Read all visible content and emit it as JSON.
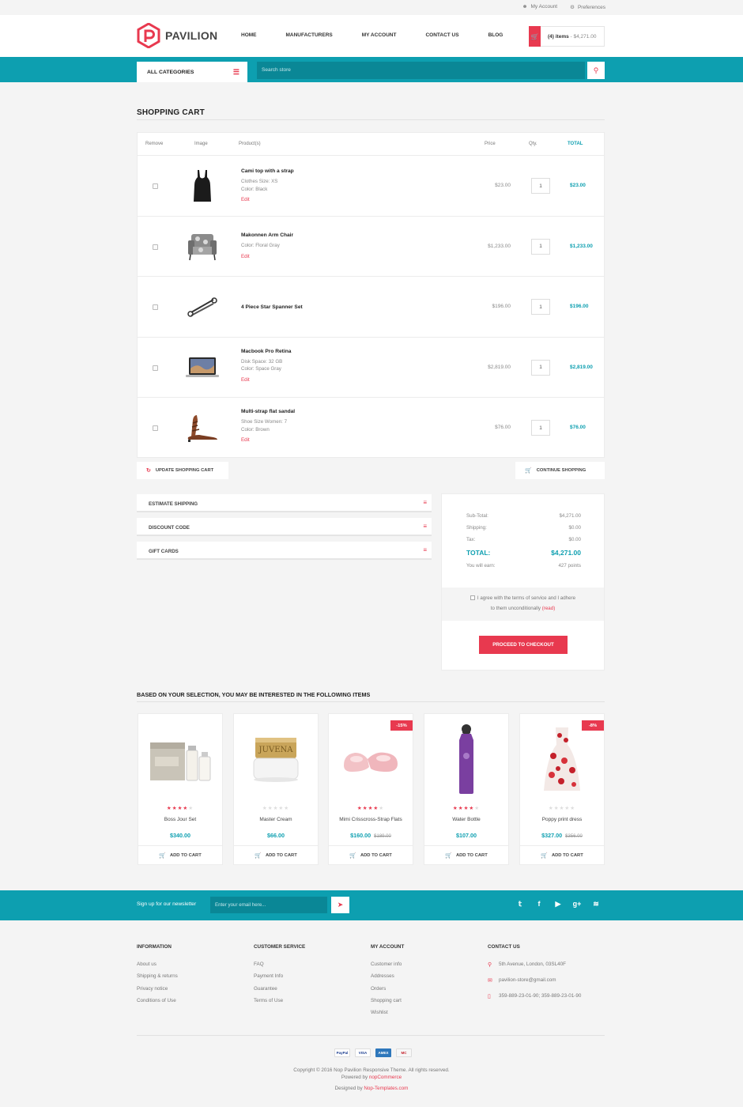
{
  "topbar": {
    "my_account": "My Account",
    "preferences": "Preferences"
  },
  "brand": {
    "name": "PAVILION",
    "accent": "#e8394f",
    "teal": "#0d9fb0"
  },
  "nav": [
    "HOME",
    "MANUFACTURERS",
    "MY ACCOUNT",
    "CONTACT US",
    "BLOG"
  ],
  "minicart": {
    "count": "(4) items",
    "amount": "- $4,271.00"
  },
  "search": {
    "categories": "ALL CATEGORIES",
    "placeholder": "Search store"
  },
  "page_title": "SHOPPING CART",
  "cart": {
    "headers": {
      "remove": "Remove",
      "image": "Image",
      "product": "Product(s)",
      "price": "Price",
      "qty": "Qty.",
      "total": "TOTAL"
    },
    "items": [
      {
        "name": "Cami top with a strap",
        "attrs": [
          "Clothes Size: XS",
          "Color: Black"
        ],
        "edit": "Edit",
        "price": "$23.00",
        "qty": "1",
        "total": "$23.00"
      },
      {
        "name": "Makonnen Arm Chair",
        "attrs": [
          "Color: Floral Gray"
        ],
        "edit": "Edit",
        "price": "$1,233.00",
        "qty": "1",
        "total": "$1,233.00"
      },
      {
        "name": "4 Piece Star Spanner Set",
        "attrs": [],
        "edit": "",
        "price": "$196.00",
        "qty": "1",
        "total": "$196.00"
      },
      {
        "name": "Macbook Pro Retina",
        "attrs": [
          "Disk Space: 32 GB",
          "Color: Space Gray"
        ],
        "edit": "Edit",
        "price": "$2,819.00",
        "qty": "1",
        "total": "$2,819.00"
      },
      {
        "name": "Multi-strap flat sandal",
        "attrs": [
          "Shoe Size Women: 7",
          "Color: Brown"
        ],
        "edit": "Edit",
        "price": "$76.00",
        "qty": "1",
        "total": "$76.00"
      }
    ],
    "update_label": "UPDATE SHOPPING CART",
    "continue_label": "CONTINUE SHOPPING"
  },
  "accordions": [
    "ESTIMATE SHIPPING",
    "DISCOUNT CODE",
    "GIFT CARDS"
  ],
  "totals": {
    "subtotal_label": "Sub-Total:",
    "subtotal": "$4,271.00",
    "shipping_label": "Shipping:",
    "shipping": "$0.00",
    "tax_label": "Tax:",
    "tax": "$0.00",
    "total_label": "TOTAL:",
    "total": "$4,271.00",
    "earn_label": "You will earn:",
    "earn": "427 points",
    "agree_line1": "I agree with the terms of service and I adhere",
    "agree_line2": "to them unconditionally",
    "read": "(read)",
    "checkout": "PROCEED TO CHECKOUT"
  },
  "crosssell_title": "BASED ON YOUR SELECTION, YOU MAY BE INTERESTED IN THE FOLLOWING ITEMS",
  "crosssell": [
    {
      "name": "Boss Jour Set",
      "price": "$340.00",
      "old": "",
      "badge": "",
      "rating": 4,
      "add": "ADD TO CART"
    },
    {
      "name": "Master Cream",
      "price": "$66.00",
      "old": "",
      "badge": "",
      "rating": 0,
      "add": "ADD TO CART"
    },
    {
      "name": "Mimi Crisscross-Strap Flats",
      "price": "$160.00",
      "old": "$189.00",
      "badge": "-15%",
      "rating": 4,
      "add": "ADD TO CART"
    },
    {
      "name": "Water Bottle",
      "price": "$107.00",
      "old": "",
      "badge": "",
      "rating": 4,
      "add": "ADD TO CART"
    },
    {
      "name": "Poppy print dress",
      "price": "$327.00",
      "old": "$356.00",
      "badge": "-8%",
      "rating": 0,
      "add": "ADD TO CART"
    }
  ],
  "newsletter": {
    "label": "Sign up for our newsletter",
    "placeholder": "Enter your email here..."
  },
  "social": [
    "twitter-icon",
    "facebook-icon",
    "youtube-icon",
    "google-plus-icon",
    "rss-icon"
  ],
  "footer": {
    "information": {
      "title": "INFORMATION",
      "links": [
        "About us",
        "Shipping & returns",
        "Privacy notice",
        "Conditions of Use"
      ]
    },
    "customer_service": {
      "title": "CUSTOMER SERVICE",
      "links": [
        "FAQ",
        "Payment Info",
        "Guarantee",
        "Terms of Use"
      ]
    },
    "my_account": {
      "title": "MY ACCOUNT",
      "links": [
        "Customer info",
        "Addresses",
        "Orders",
        "Shopping cart",
        "Wishlist"
      ]
    },
    "contact": {
      "title": "CONTACT US",
      "address": "5th Avenue, London, 03SL40F",
      "email": "pavilion-store@gmail.com",
      "phone": "359-889-23-01-90; 359-889-23-01-90"
    }
  },
  "payments": [
    "PayPal",
    "VISA",
    "AMEX",
    "MC"
  ],
  "copyright": "Copyright © 2016 Nop Pavilion Responsive Theme. All rights reserved.",
  "powered_prefix": "Powered by ",
  "powered_by": "nopCommerce",
  "designed_prefix": "Designed by ",
  "designed_by": "Nop-Templates.com"
}
